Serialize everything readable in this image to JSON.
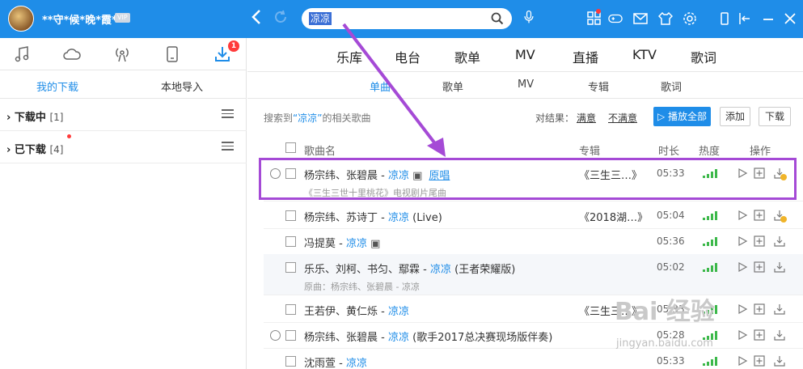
{
  "user": {
    "name": "**守*候*晚*霞**",
    "vip": "VIP"
  },
  "search": {
    "value": "凉凉"
  },
  "left": {
    "badge": "1",
    "tabs": [
      "我的下载",
      "本地导入"
    ],
    "rows": [
      {
        "label": "下载中",
        "count": "[1]"
      },
      {
        "label": "已下载",
        "count": "[4]"
      }
    ]
  },
  "main_tabs": [
    "乐库",
    "电台",
    "歌单",
    "MV",
    "直播",
    "KTV",
    "歌词"
  ],
  "sub_tabs": [
    "单曲",
    "歌单",
    "MV",
    "专辑",
    "歌词"
  ],
  "results": {
    "prefix": "搜索到",
    "keyword": "“凉凉”",
    "suffix": "的相关歌曲",
    "filter_label": "对结果：",
    "satisfied": "满意",
    "unsatisfied": "不满意",
    "play_all": "播放全部",
    "add": "添加",
    "download": "下载"
  },
  "columns": {
    "name": "歌曲名",
    "album": "专辑",
    "duration": "时长",
    "heat": "热度",
    "action": "操作"
  },
  "songs": [
    {
      "artist": "杨宗纬、张碧晨 - ",
      "song": "凉凉",
      "extra": "",
      "tag": "原唱",
      "album": "《三生三…》",
      "duration": "05:33",
      "sub": "《三生三世十里桃花》电视剧片尾曲"
    },
    {
      "artist": "杨宗纬、苏诗丁 - ",
      "song": "凉凉",
      "extra": " (Live)",
      "tag": "",
      "album": "《2018湖…》",
      "duration": "05:04",
      "sub": ""
    },
    {
      "artist": "冯提莫 - ",
      "song": "凉凉",
      "extra": "",
      "tag": "",
      "album": "",
      "duration": "05:36",
      "sub": ""
    },
    {
      "artist": "乐乐、刘柯、书匀、鄢霖 - ",
      "song": "凉凉",
      "extra": " (王者荣耀版)",
      "tag": "",
      "album": "",
      "duration": "05:02",
      "sub": "原曲：杨宗纬、张碧晨 - 凉凉"
    },
    {
      "artist": "王若伊、黄仁烁 - ",
      "song": "凉凉",
      "extra": "",
      "tag": "",
      "album": "《三生三…》",
      "duration": "05:33",
      "sub": ""
    },
    {
      "artist": "杨宗纬、张碧晨 - ",
      "song": "凉凉",
      "extra": " (歌手2017总决赛现场版伴奏)",
      "tag": "",
      "album": "",
      "duration": "05:28",
      "sub": ""
    },
    {
      "artist": "沈雨萱 - ",
      "song": "凉凉",
      "extra": "",
      "tag": "",
      "album": "",
      "duration": "05:33",
      "sub": ""
    }
  ],
  "watermark": {
    "main": "Bai 经验",
    "url": "jingyan.baidu.com"
  },
  "colors": {
    "accent": "#1f8de8",
    "highlight": "#a54ad6",
    "heat": "#3cb84a"
  }
}
